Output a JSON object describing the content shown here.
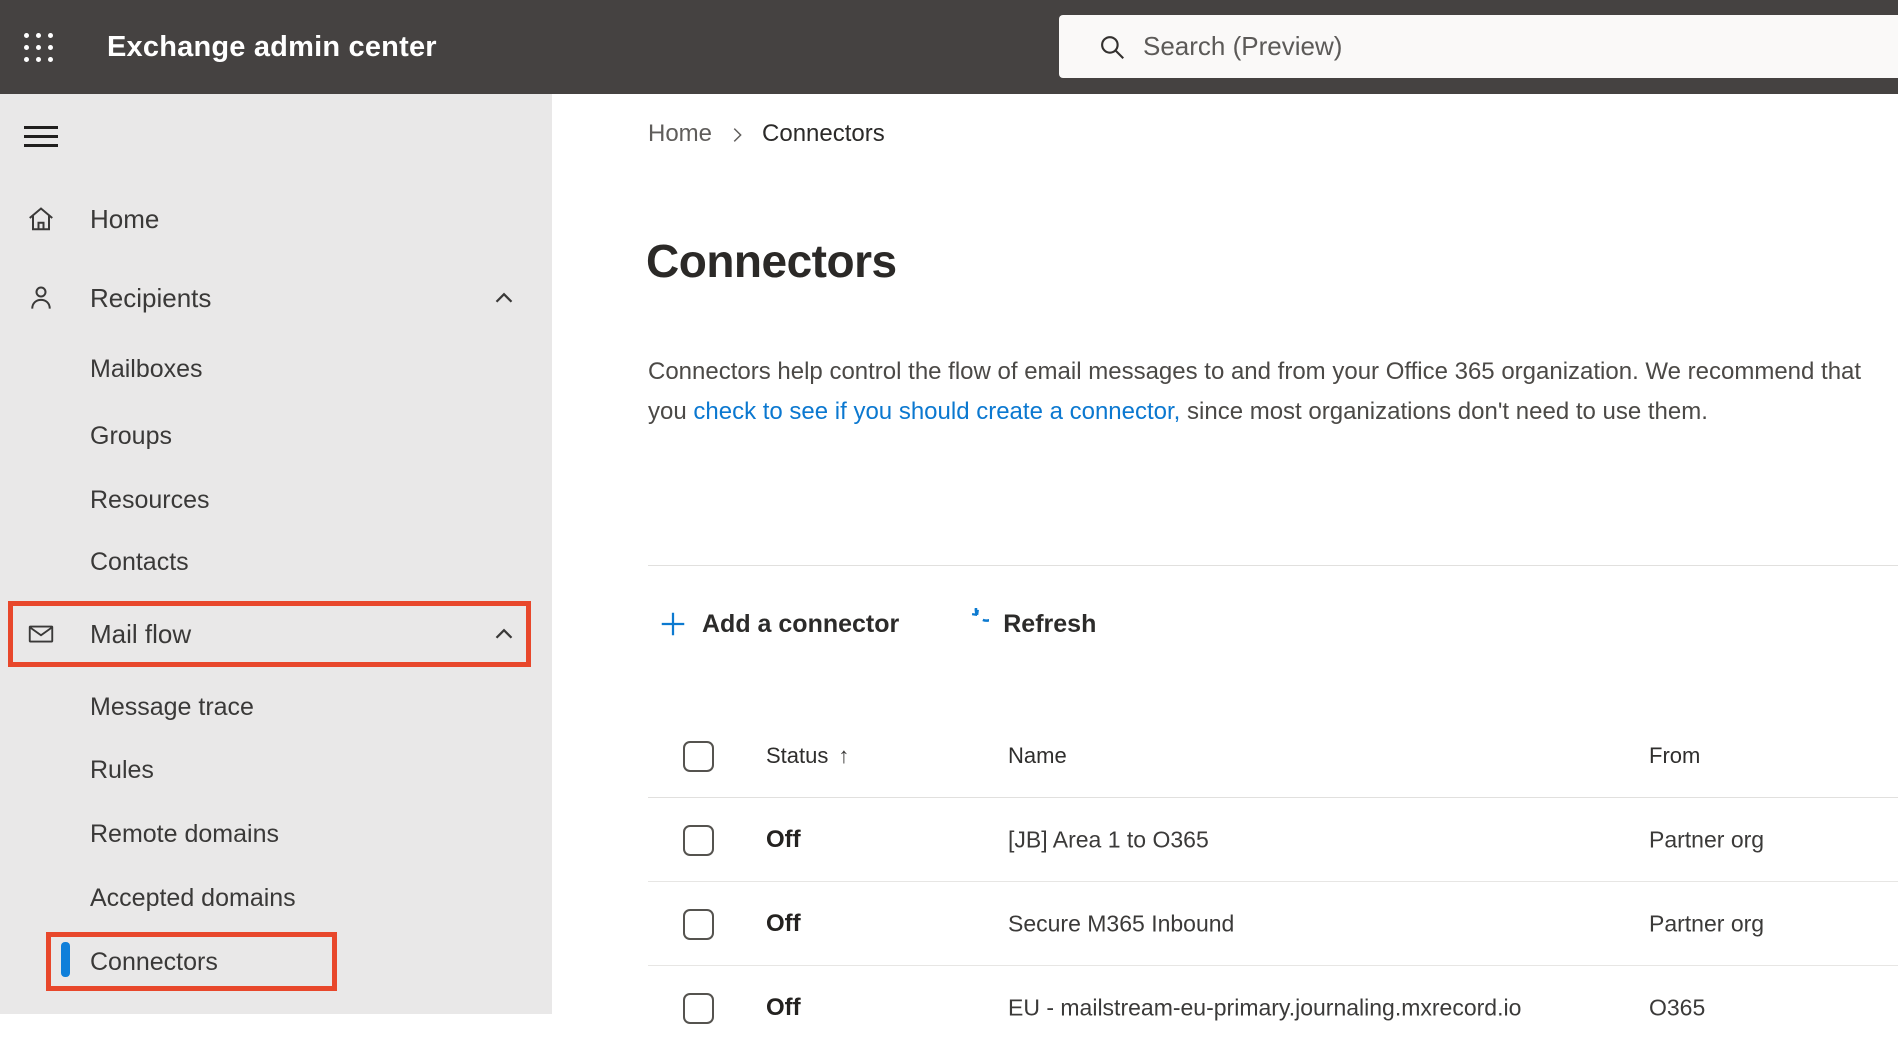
{
  "topbar": {
    "title": "Exchange admin center",
    "search_placeholder": "Search (Preview)"
  },
  "sidebar": {
    "items": [
      {
        "label": "Home"
      },
      {
        "label": "Recipients"
      },
      {
        "label": "Mailboxes"
      },
      {
        "label": "Groups"
      },
      {
        "label": "Resources"
      },
      {
        "label": "Contacts"
      },
      {
        "label": "Mail flow"
      },
      {
        "label": "Message trace"
      },
      {
        "label": "Rules"
      },
      {
        "label": "Remote domains"
      },
      {
        "label": "Accepted domains"
      },
      {
        "label": "Connectors"
      }
    ],
    "selected_item": "Connectors"
  },
  "breadcrumb": {
    "home": "Home",
    "current": "Connectors"
  },
  "page": {
    "title": "Connectors",
    "desc_before": "Connectors help control the flow of email messages to and from your Office 365 organization. We recommend that you ",
    "desc_link": "check to see if you should create a connector,",
    "desc_after": " since most organizations don't need to use them."
  },
  "toolbar": {
    "add_label": "Add a connector",
    "refresh_label": "Refresh"
  },
  "table": {
    "columns": [
      "Status",
      "Name",
      "From"
    ],
    "sort_indicator": "↑",
    "rows": [
      {
        "status": "Off",
        "name": "[JB] Area 1 to O365",
        "from": "Partner org"
      },
      {
        "status": "Off",
        "name": "Secure M365 Inbound",
        "from": "Partner org"
      },
      {
        "status": "Off",
        "name": "EU - mailstream-eu-primary.journaling.mxrecord.io",
        "from": "O365"
      }
    ]
  },
  "colors": {
    "topbar_bg": "#454241",
    "sidebar_bg": "#e9e8e8",
    "accent_blue": "#0c7ad0",
    "link_blue": "#0b78d0",
    "selection_blue": "#0f7fda",
    "annotation_red": "#e8472b"
  }
}
